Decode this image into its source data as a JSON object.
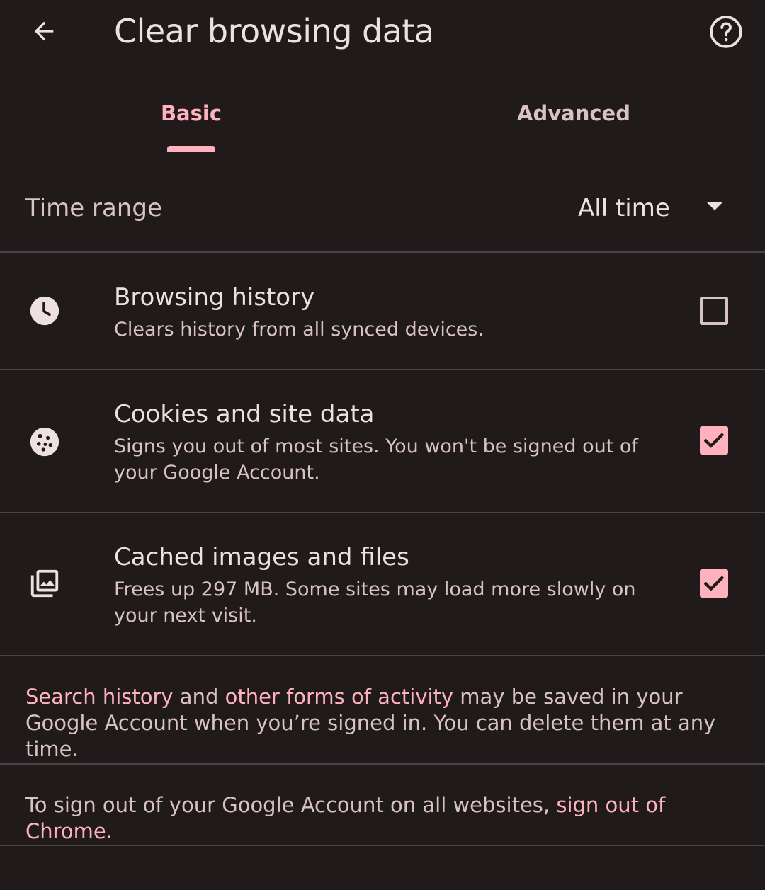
{
  "header": {
    "title": "Clear browsing data",
    "back_icon": "arrow-left",
    "help_icon": "help-circle"
  },
  "tabs": [
    {
      "label": "Basic",
      "selected": true
    },
    {
      "label": "Advanced",
      "selected": false
    }
  ],
  "time_range": {
    "label": "Time range",
    "value": "All time"
  },
  "options": [
    {
      "icon": "clock",
      "title": "Browsing history",
      "description": "Clears history from all synced devices.",
      "checked": false
    },
    {
      "icon": "cookie",
      "title": "Cookies and site data",
      "description": "Signs you out of most sites. You won't be signed out of your Google Account.",
      "checked": true
    },
    {
      "icon": "image",
      "title": "Cached images and files",
      "description": "Frees up 297 MB. Some sites may load more slowly on your next visit.",
      "checked": true
    }
  ],
  "info": {
    "search_history_link": "Search history",
    "and_text": " and ",
    "other_activity_link": "other forms of activity",
    "saved_text": " may be saved in your Google Account when you’re signed in. You can delete them at any time."
  },
  "signout": {
    "prefix": "To sign out of your Google Account on all websites, ",
    "link": "sign out of Chrome",
    "suffix": "."
  },
  "colors": {
    "background": "#201a1b",
    "accent": "#ffb2be",
    "text_primary": "#ede0e0",
    "text_secondary": "#d8c2c4",
    "divider": "#4a4245"
  }
}
